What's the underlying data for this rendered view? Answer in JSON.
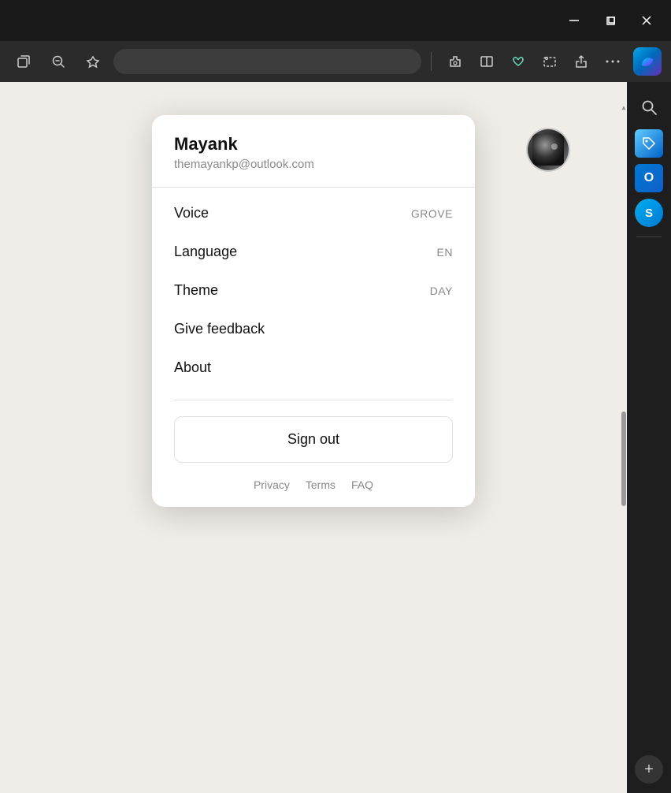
{
  "titleBar": {
    "minimizeLabel": "minimize-button",
    "maximizeLabel": "maximize-button",
    "closeLabel": "close-button"
  },
  "toolbar": {
    "openTabIcon": "⧉",
    "zoomOutIcon": "🔍",
    "bookmarkIcon": "☆",
    "extensionsIcon": "🧩",
    "splitViewIcon": "⬜",
    "heartIcon": "♡",
    "snipIcon": "⬚",
    "shareIcon": "↗",
    "moreIcon": "···"
  },
  "user": {
    "name": "Mayank",
    "email": "themayankp@outlook.com"
  },
  "menu": {
    "items": [
      {
        "label": "Voice",
        "value": "GROVE"
      },
      {
        "label": "Language",
        "value": "EN"
      },
      {
        "label": "Theme",
        "value": "DAY"
      },
      {
        "label": "Give feedback",
        "value": ""
      },
      {
        "label": "About",
        "value": ""
      }
    ],
    "signOut": "Sign out",
    "footer": [
      {
        "label": "Privacy"
      },
      {
        "label": "Terms"
      },
      {
        "label": "FAQ"
      }
    ]
  },
  "sidebar": {
    "searchIcon": "🔍",
    "tagIcon": "🏷",
    "outlookLabel": "O",
    "skypeLabel": "S",
    "addLabel": "+"
  }
}
